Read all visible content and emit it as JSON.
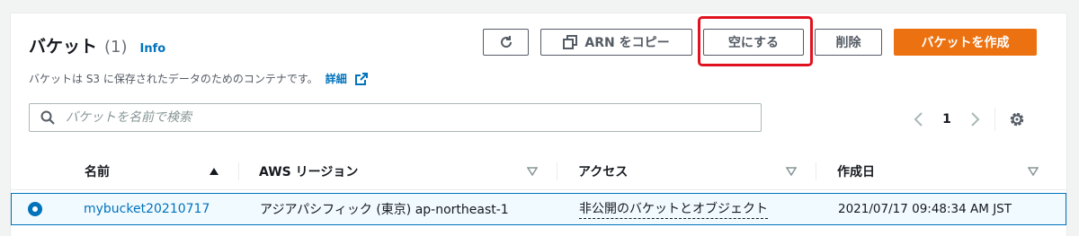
{
  "header": {
    "title": "バケット",
    "count": "(1)",
    "info_link": "Info",
    "description": "バケットは S3 に保存されたデータのためのコンテナです。",
    "details_link": "詳細"
  },
  "toolbar": {
    "copy_arn_label": "ARN をコピー",
    "empty_label": "空にする",
    "delete_label": "削除",
    "create_label": "バケットを作成"
  },
  "search": {
    "placeholder": "バケットを名前で検索"
  },
  "pagination": {
    "current_page": "1"
  },
  "table": {
    "columns": [
      "名前",
      "AWS リージョン",
      "アクセス",
      "作成日"
    ],
    "rows": [
      {
        "name": "mybucket20210717",
        "region": "アジアパシフィック (東京) ap-northeast-1",
        "access": "非公開のバケットとオブジェクト",
        "created": "2021/07/17 09:48:34 AM JST"
      }
    ]
  },
  "colors": {
    "accent_orange": "#ec7211",
    "link_blue": "#0073bb",
    "highlight_red": "#e0121f"
  },
  "icons": [
    "refresh-icon",
    "copy-icon",
    "external-link-icon",
    "search-icon",
    "chevron-left-icon",
    "chevron-right-icon",
    "gear-icon",
    "sort-asc-icon",
    "sort-desc-icon"
  ]
}
